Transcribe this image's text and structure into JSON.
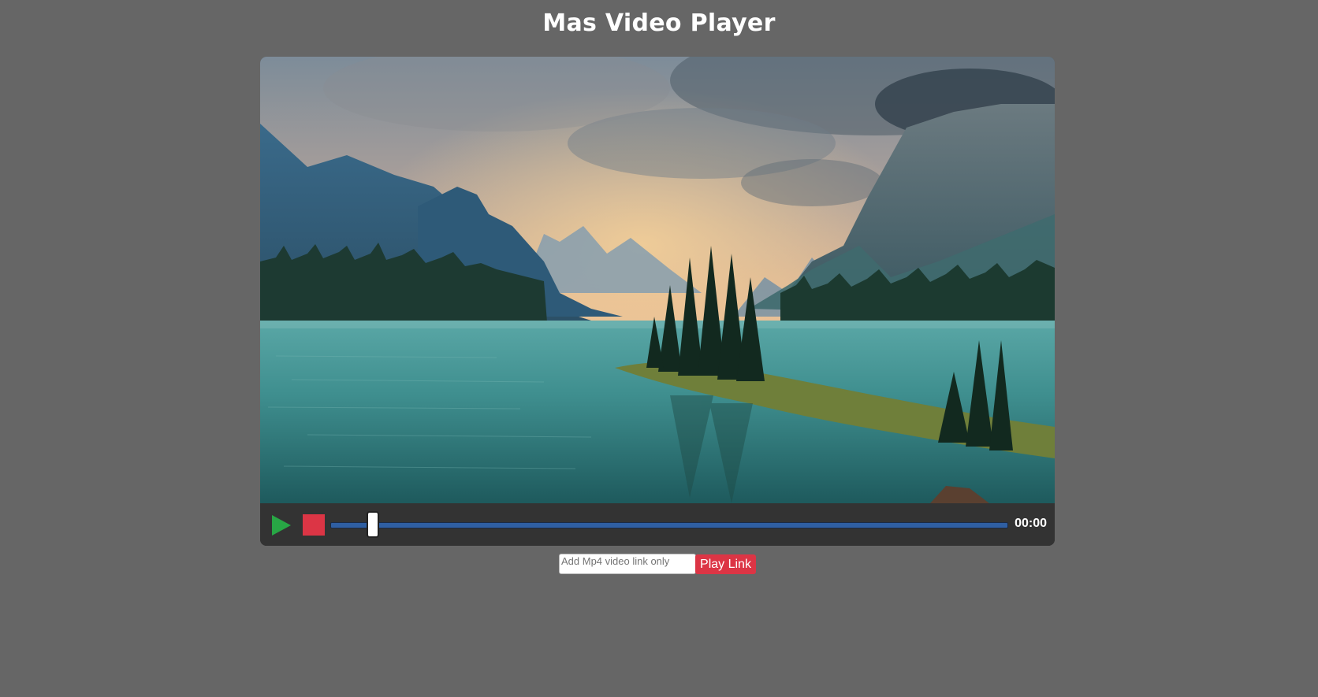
{
  "page": {
    "title": "Mas Video Player"
  },
  "player": {
    "time": "00:00",
    "seek_progress": 0.06,
    "play_icon": "play-icon",
    "stop_icon": "stop-icon"
  },
  "link_form": {
    "placeholder": "Add Mp4 video link only",
    "value": "",
    "button_label": "Play Link"
  },
  "colors": {
    "background": "#666666",
    "player_bar": "#333333",
    "play": "#28a745",
    "stop": "#dc3545",
    "seek_track": "#2f5fa3",
    "button": "#dc3545"
  }
}
